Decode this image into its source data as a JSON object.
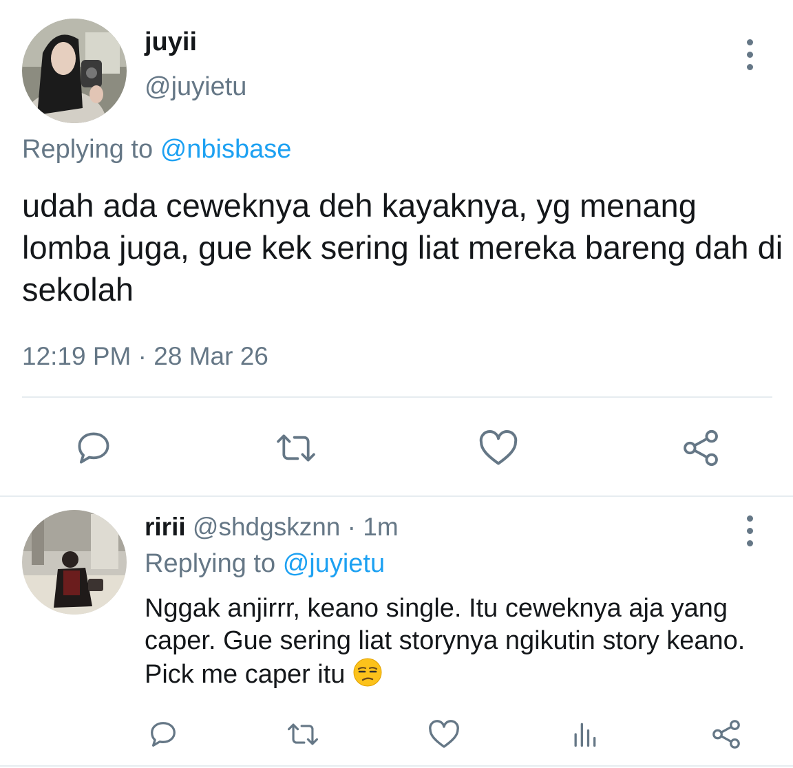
{
  "tweet": {
    "display_name": "juyii",
    "handle": "@juyietu",
    "replying_prefix": "Replying to",
    "replying_to": "@nbisbase",
    "text": "udah ada ceweknya deh kayaknya, yg menang lomba juga, gue kek sering liat mereka bareng dah di sekolah",
    "time": "12:19 PM",
    "separator": "·",
    "date": "28 Mar 26",
    "actions": [
      "reply-icon",
      "retweet-icon",
      "like-icon",
      "share-icon"
    ]
  },
  "reply": {
    "display_name": "ririi",
    "handle": "@shdgskznn",
    "separator": "·",
    "age": "1m",
    "replying_prefix": "Replying to",
    "replying_to": "@juyietu",
    "text": "Nggak anjirrr, keano single. Itu ceweknya aja yang caper. Gue sering liat storynya ngikutin story keano. Pick me caper itu",
    "emoji": "unamused-face-icon",
    "actions": [
      "reply-icon",
      "retweet-icon",
      "like-icon",
      "analytics-icon",
      "share-icon"
    ]
  },
  "colors": {
    "primary_text": "#14171a",
    "secondary_text": "#657786",
    "link": "#1da1f2",
    "divider": "#e6ecf0"
  }
}
